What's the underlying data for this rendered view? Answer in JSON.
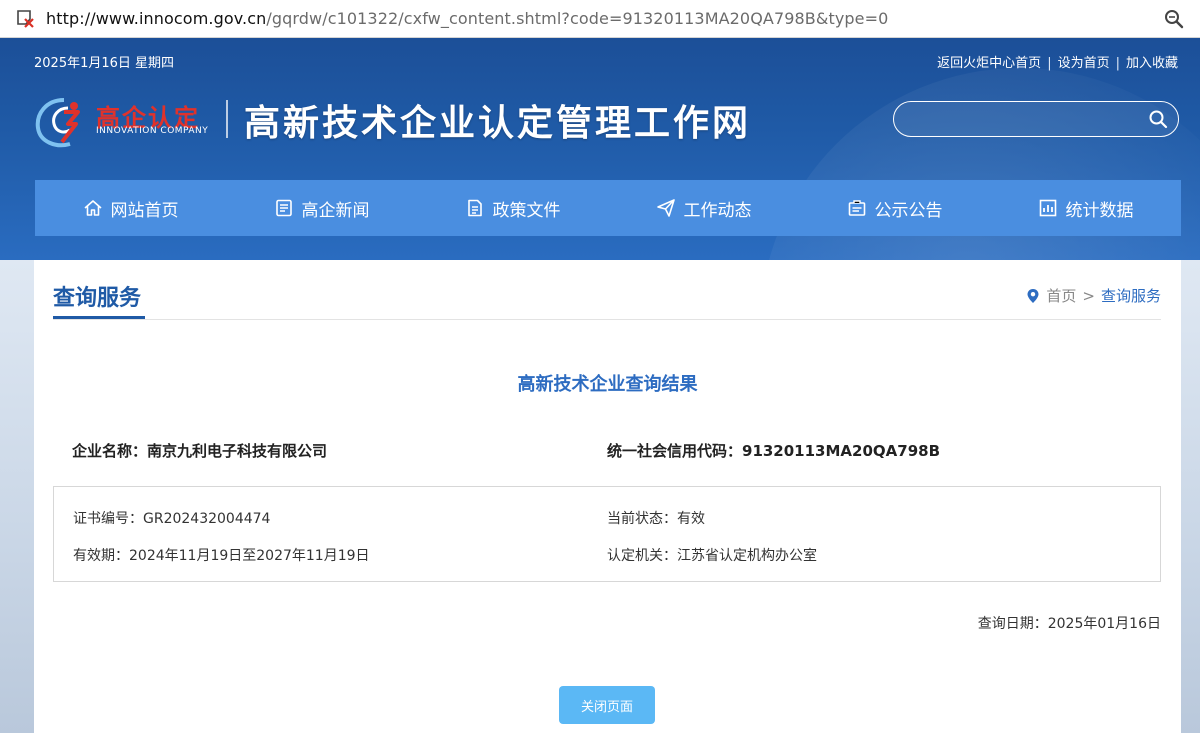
{
  "browser": {
    "url_host": "http://www.innocom.gov.cn",
    "url_path": "/gqrdw/c101322/cxfw_content.shtml?code=91320113MA20QA798B&type=0",
    "icons": [
      "not-secure-icon",
      "zoom-icon"
    ]
  },
  "topbar": {
    "date": "2025年1月16日 星期四",
    "links": [
      "返回火炬中心首页",
      "设为首页",
      "加入收藏"
    ]
  },
  "logo": {
    "cn": "高企认定",
    "en": "INNOVATION COMPANY"
  },
  "site_title": "高新技术企业认定管理工作网",
  "search": {
    "placeholder": "",
    "value": ""
  },
  "nav": [
    {
      "label": "网站首页",
      "icon": "home-icon"
    },
    {
      "label": "高企新闻",
      "icon": "news-icon"
    },
    {
      "label": "政策文件",
      "icon": "document-icon"
    },
    {
      "label": "工作动态",
      "icon": "paper-plane-icon"
    },
    {
      "label": "公示公告",
      "icon": "notice-icon"
    },
    {
      "label": "统计数据",
      "icon": "chart-icon"
    }
  ],
  "page": {
    "heading": "查询服务",
    "breadcrumb": {
      "home": "首页",
      "sep": ">",
      "current": "查询服务"
    }
  },
  "result": {
    "title": "高新技术企业查询结果",
    "company": "企业名称：南京九利电子科技有限公司",
    "credit_code": "统一社会信用代码：91320113MA20QA798B",
    "certificate": "证书编号：GR202432004474",
    "status": "当前状态：有效",
    "validity": "有效期：2024年11月19日至2027年11月19日",
    "authority": "认定机关：江苏省认定机构办公室",
    "query_date": "查询日期：2025年01月16日"
  },
  "buttons": {
    "close": "关闭页面"
  },
  "colors": {
    "header": "#1f5aa6",
    "nav": "#4a8ee0",
    "accent": "#2d6cc1",
    "button": "#5bb8f5",
    "logo_red": "#e0322b"
  }
}
